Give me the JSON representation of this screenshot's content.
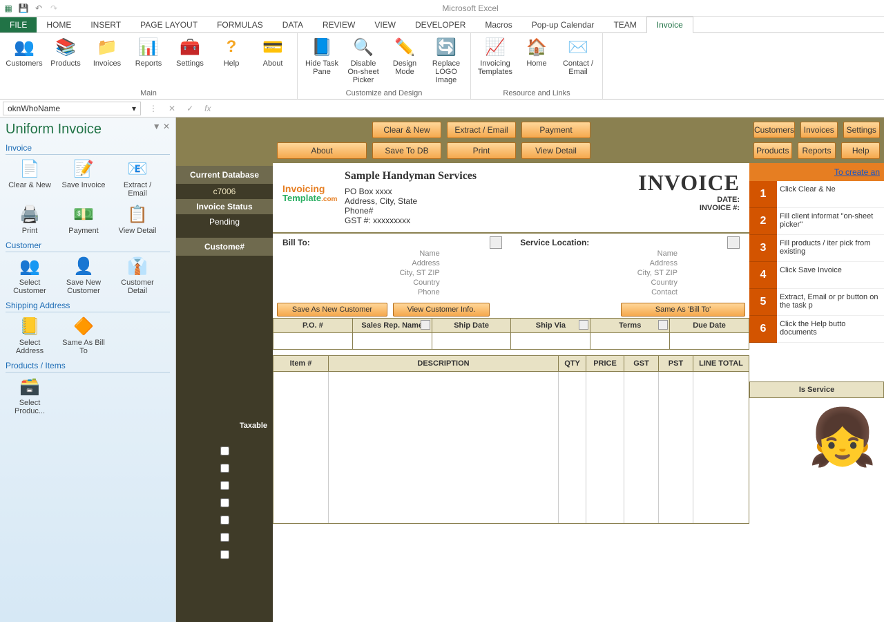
{
  "app": {
    "title": "Microsoft Excel"
  },
  "ribbon_tabs": {
    "file": "FILE",
    "tabs": [
      "HOME",
      "INSERT",
      "PAGE LAYOUT",
      "FORMULAS",
      "DATA",
      "REVIEW",
      "VIEW",
      "DEVELOPER",
      "Macros",
      "Pop-up Calendar",
      "TEAM",
      "Invoice"
    ],
    "active": "Invoice"
  },
  "ribbon": {
    "groups": [
      {
        "label": "Main",
        "items": [
          "Customers",
          "Products",
          "Invoices",
          "Reports",
          "Settings",
          "Help",
          "About"
        ]
      },
      {
        "label": "Customize and Design",
        "items": [
          "Hide Task Pane",
          "Disable On-sheet Picker",
          "Design Mode",
          "Replace LOGO Image"
        ]
      },
      {
        "label": "Resource and Links",
        "items": [
          "Invoicing Templates",
          "Home",
          "Contact / Email"
        ]
      }
    ]
  },
  "namebox": "oknWhoName",
  "taskpane": {
    "title": "Uniform Invoice",
    "sections": [
      {
        "title": "Invoice",
        "items": [
          "Clear & New",
          "Save Invoice",
          "Extract / Email",
          "Print",
          "Payment",
          "View Detail"
        ]
      },
      {
        "title": "Customer",
        "items": [
          "Select Customer",
          "Save New Customer",
          "Customer Detail"
        ]
      },
      {
        "title": "Shipping Address",
        "items": [
          "Select Address",
          "Same As Bill To"
        ]
      },
      {
        "title": "Products / Items",
        "items": [
          "Select Produc..."
        ]
      }
    ]
  },
  "leftcol": {
    "db_hdr": "Current Database",
    "db_val": "c7006",
    "inv_hdr": "Invoice Status",
    "inv_val": "Pending",
    "cust_hdr": "Custome#",
    "taxable": "Taxable"
  },
  "buttons": {
    "row1": [
      "Clear & New",
      "Extract / Email",
      "Payment"
    ],
    "row1b": [
      "Customers",
      "Invoices",
      "Settings"
    ],
    "row2": [
      "About",
      "Save To DB",
      "Print",
      "View Detail"
    ],
    "row2b": [
      "Products",
      "Reports",
      "Help"
    ],
    "cust": [
      "Save As New Customer",
      "View Customer Info.",
      "Same As 'Bill To'"
    ]
  },
  "invoice": {
    "company": "Sample Handyman Services",
    "addr1": "PO Box xxxx",
    "addr2": "Address, City, State",
    "phone": "Phone#",
    "gst": "GST #: xxxxxxxxx",
    "title": "INVOICE",
    "date_lbl": "DATE:",
    "num_lbl": "INVOICE #:",
    "logo1": "Invoicing",
    "logo2": "Template",
    "logo3": ".com"
  },
  "bill": {
    "bill_hdr": "Bill To:",
    "svc_hdr": "Service Location:",
    "fields": [
      "Name",
      "Address",
      "City, ST ZIP",
      "Country",
      "Phone"
    ],
    "svc_fields": [
      "Name",
      "Address",
      "City, ST ZIP",
      "Country",
      "Contact"
    ]
  },
  "po": {
    "headers": [
      "P.O. #",
      "Sales Rep. Name",
      "Ship Date",
      "Ship Via",
      "Terms",
      "Due Date"
    ]
  },
  "items": {
    "headers": [
      "Item #",
      "DESCRIPTION",
      "QTY",
      "PRICE",
      "GST",
      "PST",
      "LINE TOTAL"
    ]
  },
  "right": {
    "link": "To create an",
    "steps": [
      {
        "n": "1",
        "t": "Click Clear & Ne"
      },
      {
        "n": "2",
        "t": "Fill client informat \"on-sheet picker\""
      },
      {
        "n": "3",
        "t": "Fill products / iter pick from existing"
      },
      {
        "n": "4",
        "t": "Click Save Invoice"
      },
      {
        "n": "5",
        "t": "Extract, Email or pr button on the task p"
      },
      {
        "n": "6",
        "t": "Click the Help butto documents"
      }
    ],
    "is_service": "Is Service"
  }
}
